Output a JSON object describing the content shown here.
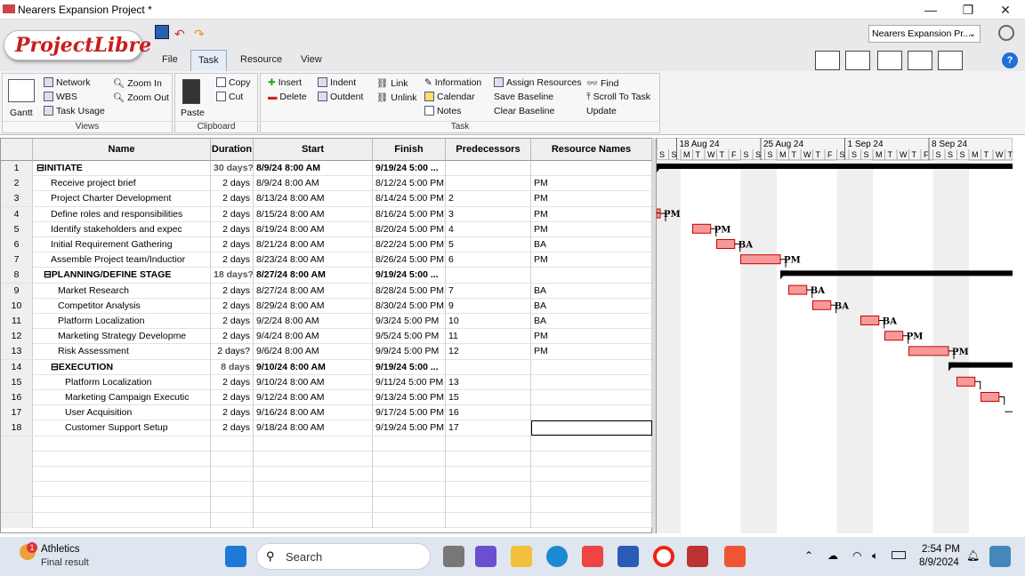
{
  "window": {
    "title": "Nearers Expansion Project *",
    "minimize": "—",
    "maximize": "❐",
    "close": "✕"
  },
  "app": {
    "logo": "ProjectLibre",
    "project_selector": "Nearers Expansion Pr...",
    "tabs": [
      "File",
      "Task",
      "Resource",
      "View"
    ],
    "selected_tab": "Task"
  },
  "ribbon": {
    "views": {
      "group": "Views",
      "gantt": "Gantt",
      "network": "Network",
      "wbs": "WBS",
      "task_usage": "Task Usage",
      "zoom_in": "Zoom In",
      "zoom_out": "Zoom Out"
    },
    "clipboard": {
      "group": "Clipboard",
      "paste": "Paste",
      "copy": "Copy",
      "cut": "Cut"
    },
    "task": {
      "group": "Task",
      "insert": "Insert",
      "delete": "Delete",
      "indent": "Indent",
      "outdent": "Outdent",
      "link": "Link",
      "unlink": "Unlink",
      "information": "Information",
      "calendar": "Calendar",
      "notes": "Notes",
      "assign_resources": "Assign Resources",
      "save_baseline": "Save Baseline",
      "clear_baseline": "Clear Baseline",
      "find": "Find",
      "scroll_to_task": "Scroll To Task",
      "update": "Update"
    }
  },
  "grid": {
    "headers": [
      "",
      "Name",
      "Duration",
      "Start",
      "Finish",
      "Predecessors",
      "Resource Names"
    ],
    "rows": [
      {
        "id": "1",
        "name": "⊟INITIATE",
        "duration": "30 days?",
        "start": "8/9/24 8:00 AM",
        "finish": "9/19/24 5:00 ...",
        "pred": "",
        "res": "",
        "level": 0,
        "summary": true
      },
      {
        "id": "2",
        "name": "Receive project brief",
        "duration": "2 days",
        "start": "8/9/24 8:00 AM",
        "finish": "8/12/24 5:00 PM",
        "pred": "",
        "res": "PM",
        "level": 1
      },
      {
        "id": "3",
        "name": "Project Charter Development",
        "duration": "2 days",
        "start": "8/13/24 8:00 AM",
        "finish": "8/14/24 5:00 PM",
        "pred": "2",
        "res": "PM",
        "level": 1
      },
      {
        "id": "4",
        "name": "Define roles and responsibilities",
        "duration": "2 days",
        "start": "8/15/24 8:00 AM",
        "finish": "8/16/24 5:00 PM",
        "pred": "3",
        "res": "PM",
        "level": 1
      },
      {
        "id": "5",
        "name": "Identify stakeholders and expec",
        "duration": "2 days",
        "start": "8/19/24 8:00 AM",
        "finish": "8/20/24 5:00 PM",
        "pred": "4",
        "res": "PM",
        "level": 1
      },
      {
        "id": "6",
        "name": "Initial Requirement Gathering",
        "duration": "2 days",
        "start": "8/21/24 8:00 AM",
        "finish": "8/22/24 5:00 PM",
        "pred": "5",
        "res": "BA",
        "level": 1
      },
      {
        "id": "7",
        "name": "Assemble Project team/Inductior",
        "duration": "2 days",
        "start": "8/23/24 8:00 AM",
        "finish": "8/26/24 5:00 PM",
        "pred": "6",
        "res": "PM",
        "level": 1
      },
      {
        "id": "8",
        "name": "⊟PLANNING/DEFINE STAGE",
        "duration": "18 days?",
        "start": "8/27/24 8:00 AM",
        "finish": "9/19/24 5:00 ...",
        "pred": "",
        "res": "",
        "level": 1,
        "summary": true
      },
      {
        "id": "9",
        "name": "Market Research",
        "duration": "2 days",
        "start": "8/27/24 8:00 AM",
        "finish": "8/28/24 5:00 PM",
        "pred": "7",
        "res": "BA",
        "level": 2
      },
      {
        "id": "10",
        "name": "Competitor Analysis",
        "duration": "2 days",
        "start": "8/29/24 8:00 AM",
        "finish": "8/30/24 5:00 PM",
        "pred": "9",
        "res": "BA",
        "level": 2
      },
      {
        "id": "11",
        "name": "Platform Localization",
        "duration": "2 days",
        "start": "9/2/24 8:00 AM",
        "finish": "9/3/24 5:00 PM",
        "pred": "10",
        "res": "BA",
        "level": 2
      },
      {
        "id": "12",
        "name": "Marketing Strategy Developme",
        "duration": "2 days",
        "start": "9/4/24 8:00 AM",
        "finish": "9/5/24 5:00 PM",
        "pred": "11",
        "res": "PM",
        "level": 2
      },
      {
        "id": "13",
        "name": "Risk Assessment",
        "duration": "2 days?",
        "start": "9/6/24 8:00 AM",
        "finish": "9/9/24 5:00 PM",
        "pred": "12",
        "res": "PM",
        "level": 2
      },
      {
        "id": "14",
        "name": "⊟EXECUTION",
        "duration": "8 days",
        "start": "9/10/24 8:00 AM",
        "finish": "9/19/24 5:00 ...",
        "pred": "",
        "res": "",
        "level": 2,
        "summary": true
      },
      {
        "id": "15",
        "name": "Platform Localization",
        "duration": "2 days",
        "start": "9/10/24 8:00 AM",
        "finish": "9/11/24 5:00 PM",
        "pred": "13",
        "res": "",
        "level": 3
      },
      {
        "id": "16",
        "name": "Marketing Campaign Executic",
        "duration": "2 days",
        "start": "9/12/24 8:00 AM",
        "finish": "9/13/24 5:00 PM",
        "pred": "15",
        "res": "",
        "level": 3
      },
      {
        "id": "17",
        "name": "User Acquisition",
        "duration": "2 days",
        "start": "9/16/24 8:00 AM",
        "finish": "9/17/24 5:00 PM",
        "pred": "16",
        "res": "",
        "level": 3
      },
      {
        "id": "18",
        "name": "Customer Support Setup",
        "duration": "2 days",
        "start": "9/18/24 8:00 AM",
        "finish": "9/19/24 5:00 PM",
        "pred": "17",
        "res": "",
        "level": 3
      }
    ]
  },
  "gantt": {
    "weeks": [
      "18 Aug 24",
      "25 Aug 24",
      "1 Sep 24",
      "8 Sep 24"
    ],
    "day_letters": "SSMTWTFSSSMTWTFSSSMTWTFSSSMTWTFS",
    "bar_labels": [
      "PM",
      "PM",
      "BA",
      "PM",
      "BA",
      "BA",
      "BA",
      "PM",
      "PM"
    ]
  },
  "taskbar": {
    "notif_title": "Athletics",
    "notif_sub": "Final result",
    "notif_badge": "1",
    "search": "Search",
    "time": "2:54 PM",
    "date": "8/9/2024"
  }
}
